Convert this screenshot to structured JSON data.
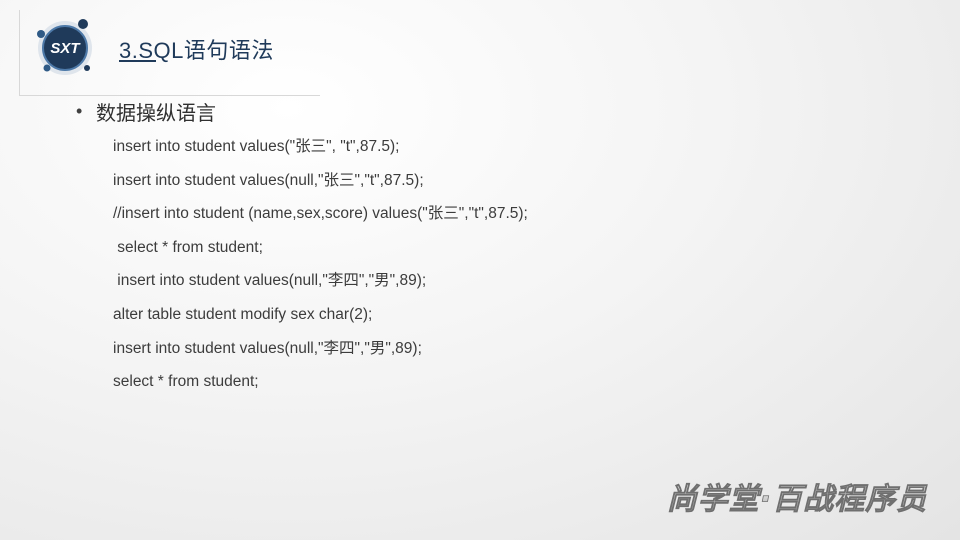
{
  "slide": {
    "logo_text": "SXT",
    "title": "3.SQL语句语法",
    "bullet": "数据操纵语言",
    "code_lines": [
      "insert into student values(\"张三\", \"t\",87.5);",
      "insert into student values(null,\"张三\",\"t\",87.5);",
      "//insert into student (name,sex,score) values(\"张三\",\"t\",87.5);",
      " select * from student;",
      " insert into student values(null,\"李四\",\"男\",89);",
      "alter table student modify sex char(2);",
      "insert into student values(null,\"李四\",\"男\",89);",
      "select * from student;"
    ],
    "watermark_text": "尚学堂·百战程序员"
  },
  "colors": {
    "title": "#1f3a5a",
    "logo_bg": "#1f3a5a",
    "logo_ring": "#2f5a86",
    "text": "#3c3c3c"
  }
}
